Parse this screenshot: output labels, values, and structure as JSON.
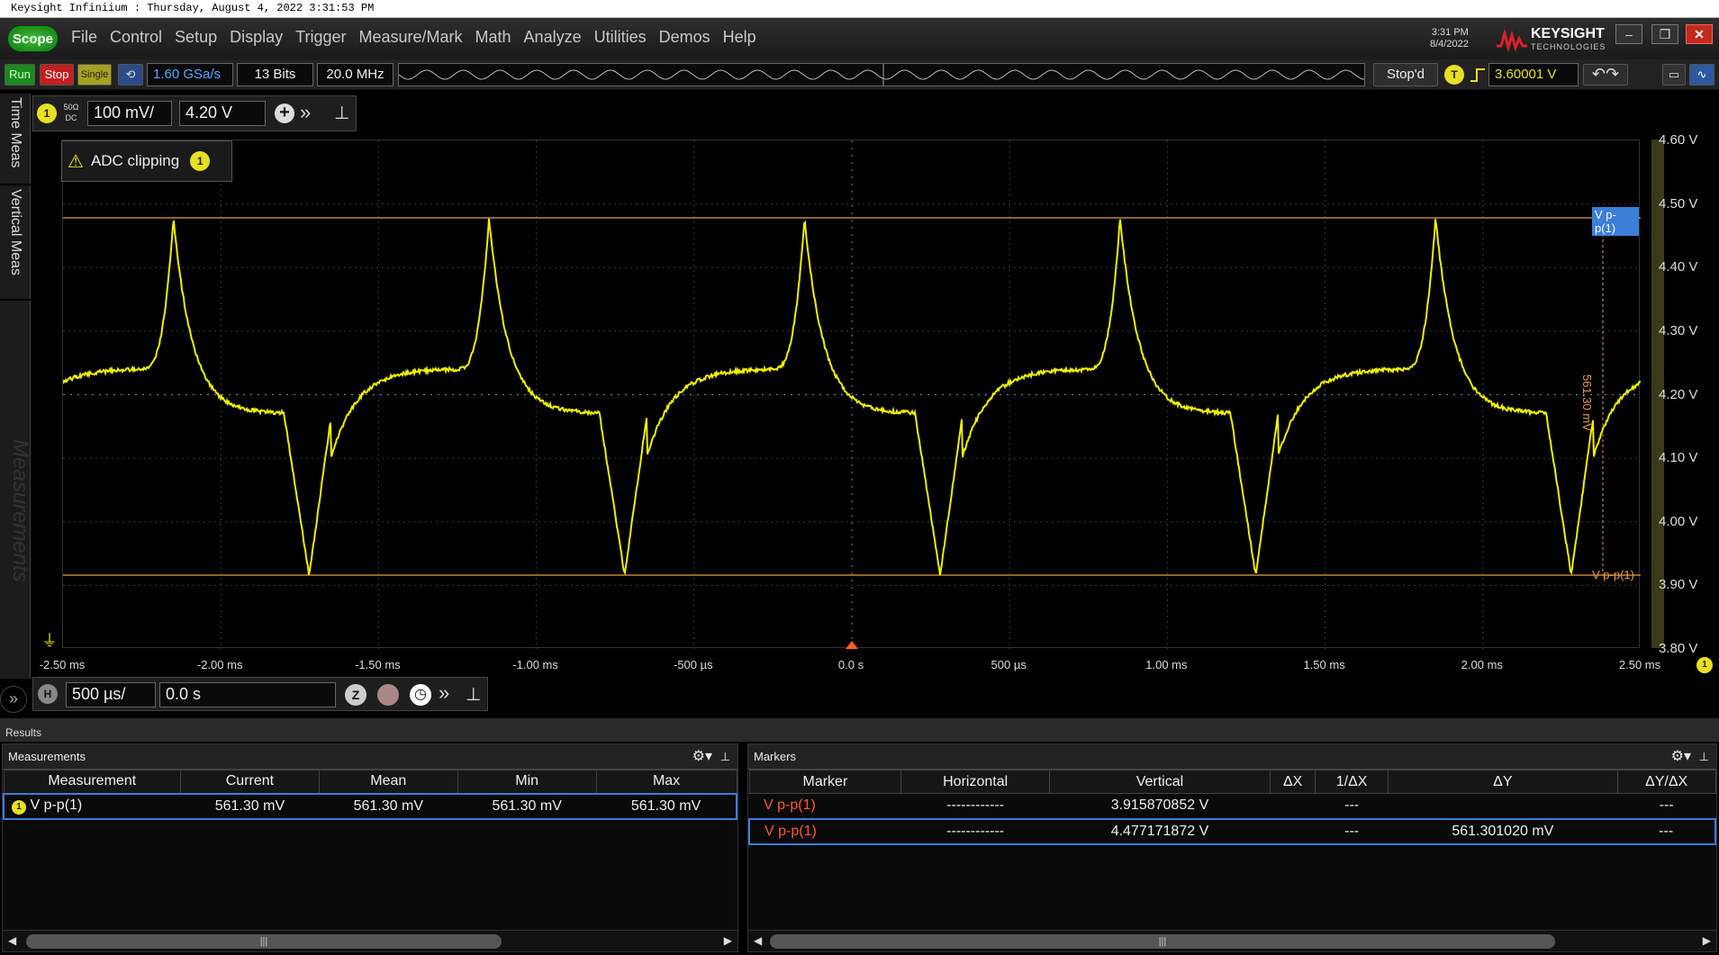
{
  "window_title": "Keysight Infiniium : Thursday, August 4, 2022 3:31:53 PM",
  "scope_label": "Scope",
  "menu": [
    "File",
    "Control",
    "Setup",
    "Display",
    "Trigger",
    "Measure/Mark",
    "Math",
    "Analyze",
    "Utilities",
    "Demos",
    "Help"
  ],
  "datetime": {
    "time": "3:31 PM",
    "date": "8/4/2022"
  },
  "brand": {
    "name": "KEYSIGHT",
    "sub": "TECHNOLOGIES"
  },
  "toolbar": {
    "run": "Run",
    "stop": "Stop",
    "single": "Single",
    "sample_rate": "1.60 GSa/s",
    "bits": "13 Bits",
    "bandwidth": "20.0 MHz",
    "status": "Stop'd",
    "trigger_level": "3.60001 V",
    "trigger_badge": "T"
  },
  "side_tabs": {
    "time_meas": "Time Meas",
    "vertical_meas": "Vertical Meas",
    "measurements_watermark": "Measurements"
  },
  "channel": {
    "num": "1",
    "coupling": "50Ω DC",
    "scale": "100 mV/",
    "offset": "4.20 V"
  },
  "alert": {
    "text": "ADC clipping",
    "channel": "1"
  },
  "y_labels": [
    "4.60 V",
    "4.50 V",
    "4.40 V",
    "4.30 V",
    "4.20 V",
    "4.10 V",
    "4.00 V",
    "3.90 V",
    "3.80 V"
  ],
  "x_labels": [
    "-2.50 ms",
    "-2.00 ms",
    "-1.50 ms",
    "-1.00 ms",
    "-500 µs",
    "0.0 s",
    "500 µs",
    "1.00 ms",
    "1.50 ms",
    "2.00 ms",
    "2.50 ms"
  ],
  "markers_on_screen": {
    "upper_label": "V p-p(1)",
    "lower_label": "V p-p(1)",
    "delta_label": "561.30 mV"
  },
  "timebase": {
    "badge": "H",
    "scale": "500 µs/",
    "position": "0.0 s"
  },
  "results_title": "Results",
  "measurements": {
    "title": "Measurements",
    "columns": [
      "Measurement",
      "Current",
      "Mean",
      "Min",
      "Max"
    ],
    "rows": [
      {
        "channel": "1",
        "name": "V p-p(1)",
        "current": "561.30 mV",
        "mean": "561.30 mV",
        "min": "561.30 mV",
        "max": "561.30 mV"
      }
    ]
  },
  "markers": {
    "title": "Markers",
    "columns": [
      "Marker",
      "Horizontal",
      "Vertical",
      "ΔX",
      "1/ΔX",
      "ΔY",
      "ΔY/ΔX"
    ],
    "rows": [
      {
        "marker": "V p-p(1)",
        "horizontal": "------------",
        "vertical": "3.915870852 V",
        "dx": "",
        "inv_dx": "---",
        "dy": "",
        "dydx": "---"
      },
      {
        "marker": "V p-p(1)",
        "horizontal": "------------",
        "vertical": "4.477171872 V",
        "dx": "",
        "inv_dx": "---",
        "dy": "561.301020 mV",
        "dydx": "---"
      }
    ]
  },
  "colors": {
    "trace": "#f0f000",
    "marker": "#e8a040",
    "accent_blue": "#3b7fd8"
  }
}
